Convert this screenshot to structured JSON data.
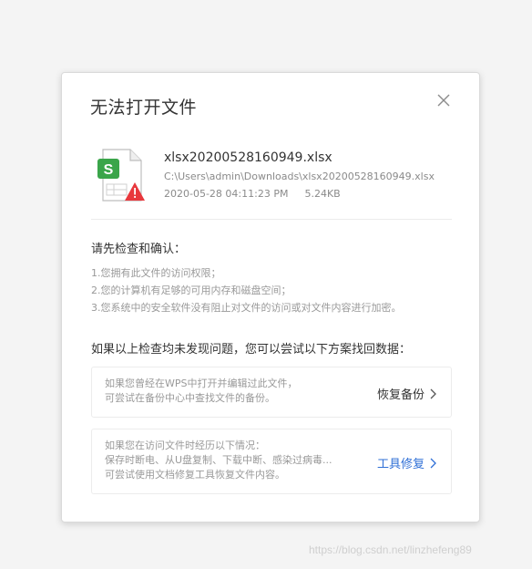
{
  "dialog": {
    "title": "无法打开文件",
    "close_icon": "close-icon"
  },
  "file": {
    "icon": "spreadsheet-file-warning-icon",
    "badge_letter": "S",
    "name": "xlsx20200528160949.xlsx",
    "path": "C:\\Users\\admin\\Downloads\\xlsx20200528160949.xlsx",
    "date": "2020-05-28  04:11:23 PM",
    "size": "5.24KB"
  },
  "checks": {
    "title": "请先检查和确认：",
    "items": [
      "1.您拥有此文件的访问权限；",
      "2.您的计算机有足够的可用内存和磁盘空间；",
      "3.您系统中的安全软件没有阻止对文件的访问或对文件内容进行加密。"
    ]
  },
  "recovery": {
    "title": "如果以上检查均未发现问题，您可以尝试以下方案找回数据：",
    "options": [
      {
        "lines": [
          "如果您曾经在WPS中打开并编辑过此文件，",
          "可尝试在备份中心中查找文件的备份。"
        ],
        "action": "恢复备份"
      },
      {
        "lines": [
          "如果您在访问文件时经历以下情况：",
          "保存时断电、从U盘复制、下载中断、感染过病毒...",
          "可尝试使用文档修复工具恢复文件内容。"
        ],
        "action": "工具修复"
      }
    ]
  },
  "watermark": "https://blog.csdn.net/linzhefeng89",
  "colors": {
    "accent_link": "#2f6fd6",
    "file_badge": "#3aa54a",
    "warning": "#e8383d"
  }
}
